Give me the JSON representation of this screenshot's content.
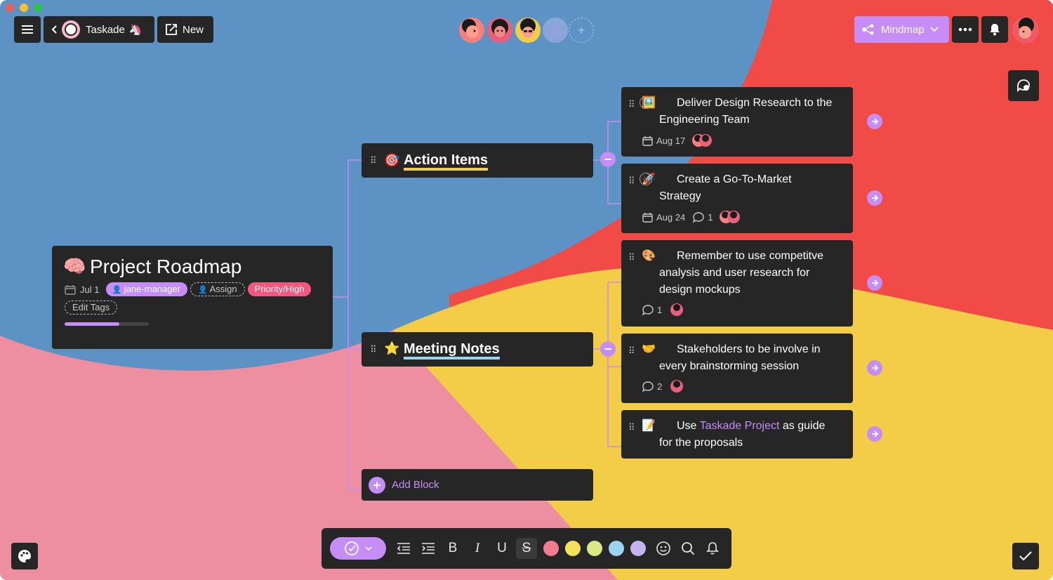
{
  "topbar": {
    "workspace_label": "Taskade",
    "new_label": "New",
    "member_count": "5",
    "view_label": "Mindmap"
  },
  "root": {
    "emoji": "🧠",
    "title": "Project Roadmap",
    "date": "Jul 1",
    "assignee": "jane-manager",
    "assign_label": "Assign",
    "priority_tag": "Priority/High",
    "edit_tags_label": "Edit Tags",
    "progress": 0.65
  },
  "branches": [
    {
      "emoji": "🎯",
      "title": "Action Items",
      "tasks": [
        {
          "emoji": "🖼️",
          "text": "Deliver Design Research to the Engineering Team",
          "date": "Aug 17"
        },
        {
          "emoji": "🚀",
          "text": "Create a Go-To-Market Strategy",
          "date": "Aug 24",
          "comments": "1"
        }
      ]
    },
    {
      "emoji": "⭐",
      "title": "Meeting Notes",
      "notes": [
        {
          "emoji": "🎨",
          "text": "Remember to use competitve analysis and user research for design mockups",
          "comments": "1"
        },
        {
          "emoji": "🤝",
          "text": "Stakeholders to be involve in every brainstorming session",
          "comments": "2"
        },
        {
          "emoji": "📝",
          "text_before": "Use ",
          "link": "Taskade Project",
          "text_after": " as guide for the proposals"
        }
      ]
    }
  ],
  "add_block_label": "Add Block",
  "toolbar": {
    "bold": "B",
    "italic": "I",
    "underline": "U",
    "strike": "S",
    "colors": [
      "#f07d8d",
      "#f6e25a",
      "#dde787",
      "#9dd4f2",
      "#c6b2f0"
    ]
  },
  "theme": {
    "blue": "#5d93c4",
    "red": "#f04b47",
    "yellow": "#f3cd47",
    "pink": "#ee8fa1",
    "accent": "#c58df5",
    "priority": "#f4577e",
    "card": "#262626"
  }
}
